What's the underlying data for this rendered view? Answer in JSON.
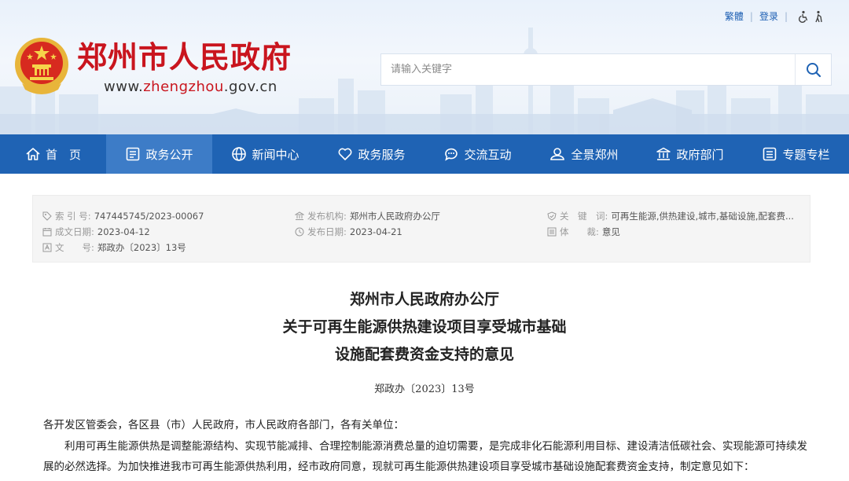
{
  "header": {
    "top_links": {
      "traditional": "繁體",
      "login": "登录"
    },
    "site_name": "郑州市人民政府",
    "url_prefix": "www.",
    "url_highlight": "zhengzhou",
    "url_suffix": ".gov.cn",
    "search_placeholder": "请输入关键字"
  },
  "colors": {
    "brand_red": "#c9151e",
    "nav_blue": "#1f63b4",
    "nav_active": "#3d7cc7"
  },
  "nav": [
    {
      "label": "首　页",
      "icon": "home-icon"
    },
    {
      "label": "政务公开",
      "icon": "document-icon",
      "active": true
    },
    {
      "label": "新闻中心",
      "icon": "globe-icon"
    },
    {
      "label": "政务服务",
      "icon": "heart-icon"
    },
    {
      "label": "交流互动",
      "icon": "chat-icon"
    },
    {
      "label": "全景郑州",
      "icon": "user-icon"
    },
    {
      "label": "政府部门",
      "icon": "building-icon"
    },
    {
      "label": "专题专栏",
      "icon": "list-icon"
    }
  ],
  "info": {
    "index_label": "索 引 号:",
    "index_value": "747445745/2023-00067",
    "date_made_label": "成文日期:",
    "date_made_value": "2023-04-12",
    "doc_label": "文　　号:",
    "doc_value": "郑政办〔2023〕13号",
    "issuer_label": "发布机构:",
    "issuer_value": "郑州市人民政府办公厅",
    "pub_date_label": "发布日期:",
    "pub_date_value": "2023-04-21",
    "keywords_label": "关　键　词:",
    "keywords_value": "可再生能源,供热建设,城市,基础设施,配套费...",
    "genre_label": "体　　裁:",
    "genre_value": "意见"
  },
  "article": {
    "title_line1": "郑州市人民政府办公厅",
    "title_line2": "关于可再生能源供热建设项目享受城市基础",
    "title_line3": "设施配套费资金支持的意见",
    "doc_number": "郑政办〔2023〕13号",
    "salutation": "各开发区管委会，各区县（市）人民政府，市人民政府各部门，各有关单位：",
    "para1_line1": "　　利用可再生能源供热是调整能源结构、实现节能减排、合理控制能源消费总量的迫切需要，是完成非化石能源利用目标、建设清洁低碳社会、实现能源可持续发",
    "para1_line2": "展的必然选择。为加快推进我市可再生能源供热利用，经市政府同意，现就可再生能源供热建设项目享受城市基础设施配套费资金支持，制定意见如下："
  }
}
